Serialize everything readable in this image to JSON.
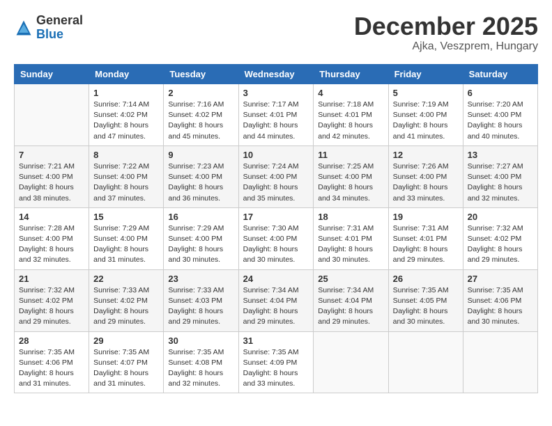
{
  "header": {
    "logo": {
      "general": "General",
      "blue": "Blue"
    },
    "title": "December 2025",
    "location": "Ajka, Veszprem, Hungary"
  },
  "calendar": {
    "days_of_week": [
      "Sunday",
      "Monday",
      "Tuesday",
      "Wednesday",
      "Thursday",
      "Friday",
      "Saturday"
    ],
    "weeks": [
      [
        {
          "day": "",
          "info": ""
        },
        {
          "day": "1",
          "info": "Sunrise: 7:14 AM\nSunset: 4:02 PM\nDaylight: 8 hours\nand 47 minutes."
        },
        {
          "day": "2",
          "info": "Sunrise: 7:16 AM\nSunset: 4:02 PM\nDaylight: 8 hours\nand 45 minutes."
        },
        {
          "day": "3",
          "info": "Sunrise: 7:17 AM\nSunset: 4:01 PM\nDaylight: 8 hours\nand 44 minutes."
        },
        {
          "day": "4",
          "info": "Sunrise: 7:18 AM\nSunset: 4:01 PM\nDaylight: 8 hours\nand 42 minutes."
        },
        {
          "day": "5",
          "info": "Sunrise: 7:19 AM\nSunset: 4:00 PM\nDaylight: 8 hours\nand 41 minutes."
        },
        {
          "day": "6",
          "info": "Sunrise: 7:20 AM\nSunset: 4:00 PM\nDaylight: 8 hours\nand 40 minutes."
        }
      ],
      [
        {
          "day": "7",
          "info": "Sunrise: 7:21 AM\nSunset: 4:00 PM\nDaylight: 8 hours\nand 38 minutes."
        },
        {
          "day": "8",
          "info": "Sunrise: 7:22 AM\nSunset: 4:00 PM\nDaylight: 8 hours\nand 37 minutes."
        },
        {
          "day": "9",
          "info": "Sunrise: 7:23 AM\nSunset: 4:00 PM\nDaylight: 8 hours\nand 36 minutes."
        },
        {
          "day": "10",
          "info": "Sunrise: 7:24 AM\nSunset: 4:00 PM\nDaylight: 8 hours\nand 35 minutes."
        },
        {
          "day": "11",
          "info": "Sunrise: 7:25 AM\nSunset: 4:00 PM\nDaylight: 8 hours\nand 34 minutes."
        },
        {
          "day": "12",
          "info": "Sunrise: 7:26 AM\nSunset: 4:00 PM\nDaylight: 8 hours\nand 33 minutes."
        },
        {
          "day": "13",
          "info": "Sunrise: 7:27 AM\nSunset: 4:00 PM\nDaylight: 8 hours\nand 32 minutes."
        }
      ],
      [
        {
          "day": "14",
          "info": "Sunrise: 7:28 AM\nSunset: 4:00 PM\nDaylight: 8 hours\nand 32 minutes."
        },
        {
          "day": "15",
          "info": "Sunrise: 7:29 AM\nSunset: 4:00 PM\nDaylight: 8 hours\nand 31 minutes."
        },
        {
          "day": "16",
          "info": "Sunrise: 7:29 AM\nSunset: 4:00 PM\nDaylight: 8 hours\nand 30 minutes."
        },
        {
          "day": "17",
          "info": "Sunrise: 7:30 AM\nSunset: 4:00 PM\nDaylight: 8 hours\nand 30 minutes."
        },
        {
          "day": "18",
          "info": "Sunrise: 7:31 AM\nSunset: 4:01 PM\nDaylight: 8 hours\nand 30 minutes."
        },
        {
          "day": "19",
          "info": "Sunrise: 7:31 AM\nSunset: 4:01 PM\nDaylight: 8 hours\nand 29 minutes."
        },
        {
          "day": "20",
          "info": "Sunrise: 7:32 AM\nSunset: 4:02 PM\nDaylight: 8 hours\nand 29 minutes."
        }
      ],
      [
        {
          "day": "21",
          "info": "Sunrise: 7:32 AM\nSunset: 4:02 PM\nDaylight: 8 hours\nand 29 minutes."
        },
        {
          "day": "22",
          "info": "Sunrise: 7:33 AM\nSunset: 4:02 PM\nDaylight: 8 hours\nand 29 minutes."
        },
        {
          "day": "23",
          "info": "Sunrise: 7:33 AM\nSunset: 4:03 PM\nDaylight: 8 hours\nand 29 minutes."
        },
        {
          "day": "24",
          "info": "Sunrise: 7:34 AM\nSunset: 4:04 PM\nDaylight: 8 hours\nand 29 minutes."
        },
        {
          "day": "25",
          "info": "Sunrise: 7:34 AM\nSunset: 4:04 PM\nDaylight: 8 hours\nand 29 minutes."
        },
        {
          "day": "26",
          "info": "Sunrise: 7:35 AM\nSunset: 4:05 PM\nDaylight: 8 hours\nand 30 minutes."
        },
        {
          "day": "27",
          "info": "Sunrise: 7:35 AM\nSunset: 4:06 PM\nDaylight: 8 hours\nand 30 minutes."
        }
      ],
      [
        {
          "day": "28",
          "info": "Sunrise: 7:35 AM\nSunset: 4:06 PM\nDaylight: 8 hours\nand 31 minutes."
        },
        {
          "day": "29",
          "info": "Sunrise: 7:35 AM\nSunset: 4:07 PM\nDaylight: 8 hours\nand 31 minutes."
        },
        {
          "day": "30",
          "info": "Sunrise: 7:35 AM\nSunset: 4:08 PM\nDaylight: 8 hours\nand 32 minutes."
        },
        {
          "day": "31",
          "info": "Sunrise: 7:35 AM\nSunset: 4:09 PM\nDaylight: 8 hours\nand 33 minutes."
        },
        {
          "day": "",
          "info": ""
        },
        {
          "day": "",
          "info": ""
        },
        {
          "day": "",
          "info": ""
        }
      ]
    ]
  }
}
